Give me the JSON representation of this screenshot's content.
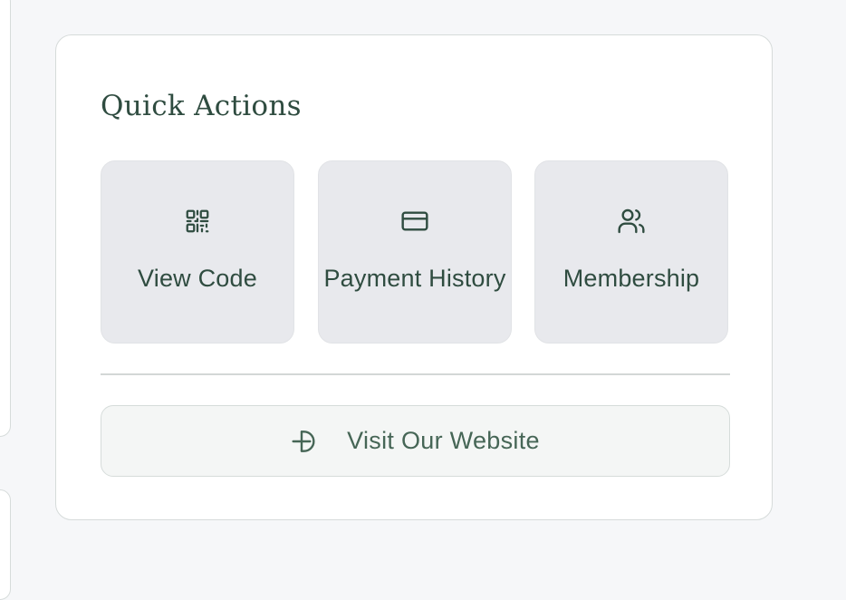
{
  "colors": {
    "accent": "#2f4c40",
    "tile_background": "#e8e9ed",
    "page_background": "#f6f7f9",
    "card_background": "#ffffff"
  },
  "quick_actions": {
    "title": "Quick Actions",
    "actions": [
      {
        "label": "View Code",
        "icon": "qr-code-icon"
      },
      {
        "label": "Payment History",
        "icon": "credit-card-icon"
      },
      {
        "label": "Membership",
        "icon": "users-icon"
      }
    ],
    "website_button": {
      "label": "Visit Our Website",
      "icon": "external-link-icon"
    }
  }
}
